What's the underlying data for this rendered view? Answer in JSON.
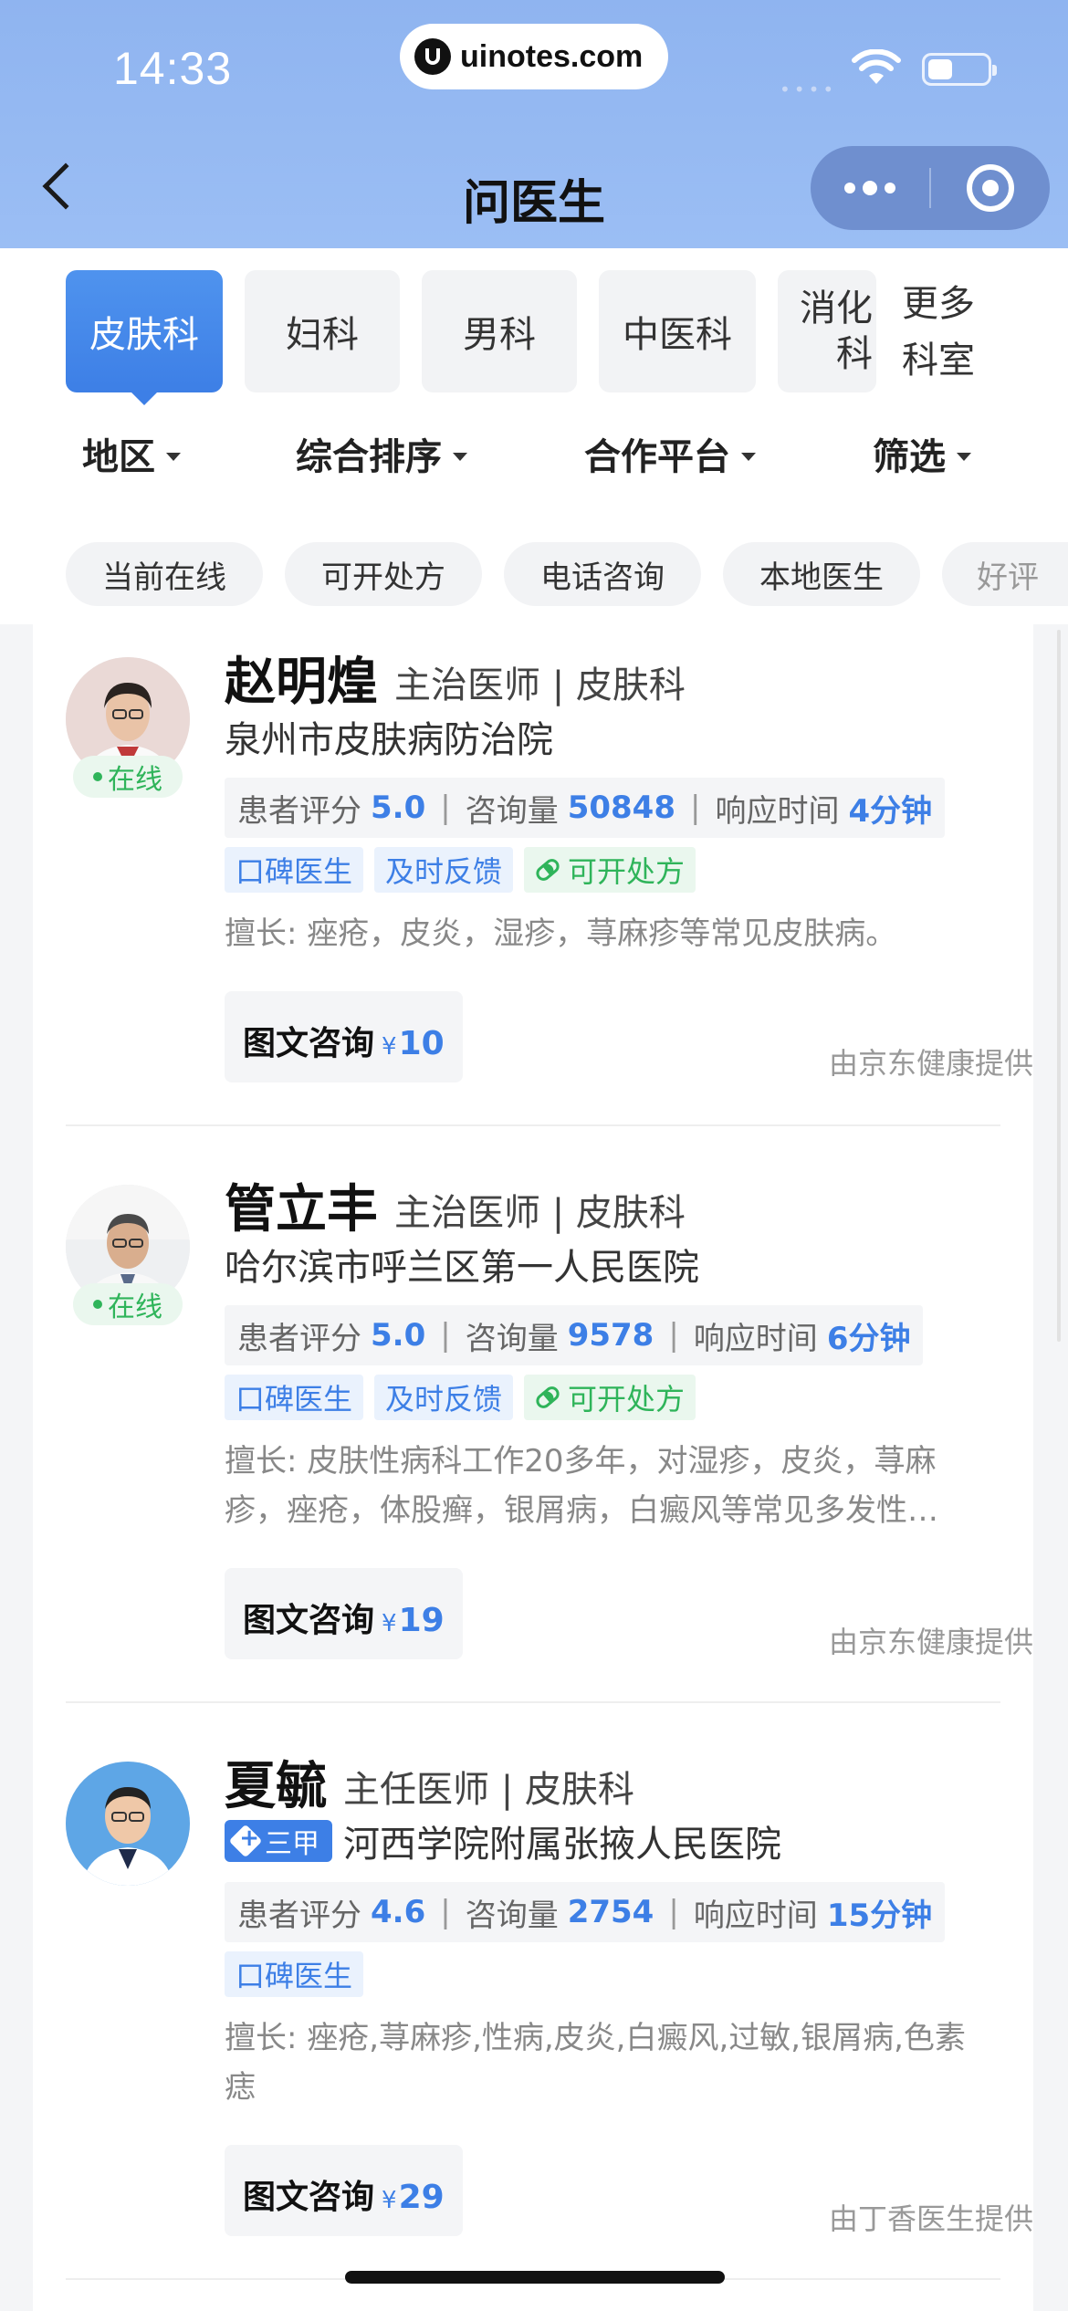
{
  "status_bar": {
    "time": "14:33",
    "url": "uinotes.com",
    "signal_dots": "••••"
  },
  "nav": {
    "title": "问医生"
  },
  "departments": [
    {
      "label": "皮肤科",
      "active": true
    },
    {
      "label": "妇科",
      "active": false
    },
    {
      "label": "男科",
      "active": false
    },
    {
      "label": "中医科",
      "active": false
    },
    {
      "label": "消化科",
      "active": false
    }
  ],
  "more_departments": "更多科室",
  "sort_options": [
    "地区",
    "综合排序",
    "合作平台",
    "筛选"
  ],
  "quick_filters": [
    "当前在线",
    "可开处方",
    "电话咨询",
    "本地医生",
    "好评"
  ],
  "doctors": [
    {
      "name": "赵明煌",
      "title": "主治医师 | 皮肤科",
      "hospital": "泉州市皮肤病防治院",
      "grade": "",
      "online": "在线",
      "rating_label": "患者评分",
      "rating": "5.0",
      "consult_label": "咨询量",
      "consults": "50848",
      "response_label": "响应时间",
      "response": "4分钟",
      "tags": [
        "口碑医生",
        "及时反馈"
      ],
      "prescription_tag": "可开处方",
      "expertise": "擅长: 痤疮，皮炎，湿疹，荨麻疹等常见皮肤病。",
      "consult_type": "图文咨询",
      "currency": "¥",
      "price": "10",
      "provider": "由京东健康提供"
    },
    {
      "name": "管立丰",
      "title": "主治医师 | 皮肤科",
      "hospital": "哈尔滨市呼兰区第一人民医院",
      "grade": "",
      "online": "在线",
      "rating_label": "患者评分",
      "rating": "5.0",
      "consult_label": "咨询量",
      "consults": "9578",
      "response_label": "响应时间",
      "response": "6分钟",
      "tags": [
        "口碑医生",
        "及时反馈"
      ],
      "prescription_tag": "可开处方",
      "expertise": "擅长: 皮肤性病科工作20多年，对湿疹，皮炎，荨麻疹，痤疮，体股癣，银屑病，白癜风等常见多发性…",
      "consult_type": "图文咨询",
      "currency": "¥",
      "price": "19",
      "provider": "由京东健康提供"
    },
    {
      "name": "夏毓",
      "title": "主任医师 | 皮肤科",
      "hospital": "河西学院附属张掖人民医院",
      "grade": "三甲",
      "online": "",
      "rating_label": "患者评分",
      "rating": "4.6",
      "consult_label": "咨询量",
      "consults": "2754",
      "response_label": "响应时间",
      "response": "15分钟",
      "tags": [
        "口碑医生"
      ],
      "prescription_tag": "",
      "expertise": "擅长: 痤疮,荨麻疹,性病,皮炎,白癜风,过敏,银屑病,色素痣",
      "consult_type": "图文咨询",
      "currency": "¥",
      "price": "29",
      "provider": "由丁香医生提供"
    }
  ],
  "colors": {
    "accent": "#3d7fe6",
    "online": "#2fb45a",
    "header": "#9bbef4"
  }
}
